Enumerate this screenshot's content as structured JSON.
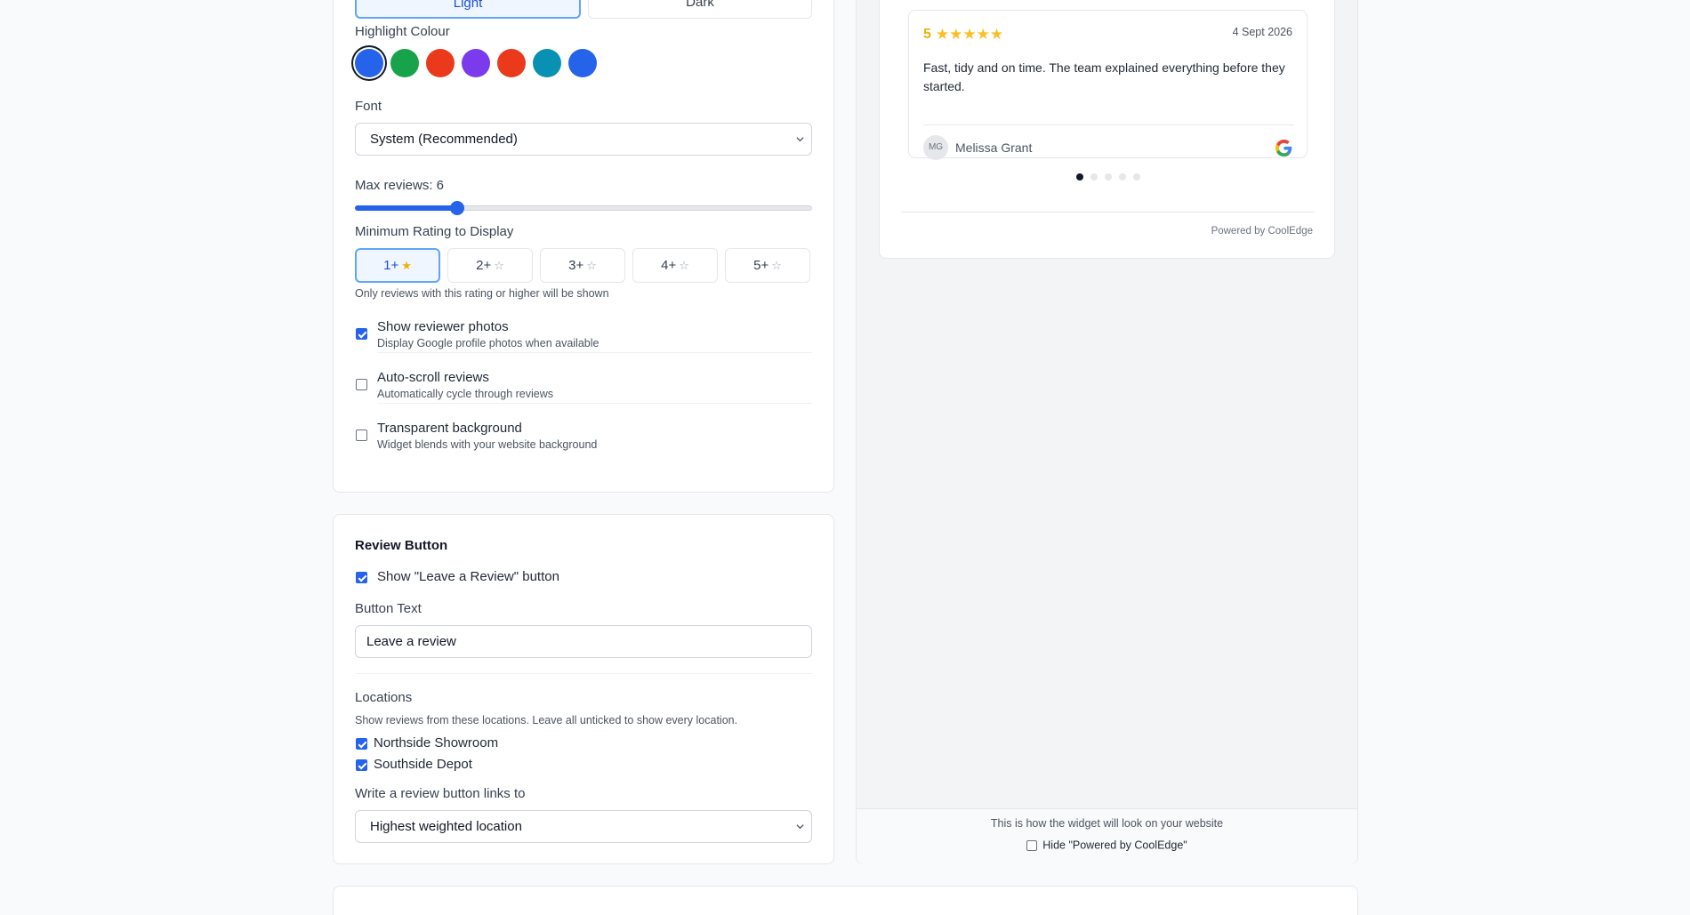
{
  "theme": {
    "light_label": "Light",
    "dark_label": "Dark"
  },
  "highlight": {
    "label": "Highlight Colour",
    "swatches": [
      "#2563eb",
      "#16a34a",
      "#ea3a1b",
      "#7c3aed",
      "#ea3a1b",
      "#0891b2",
      "#2563eb"
    ]
  },
  "font": {
    "label": "Font",
    "value": "System (Recommended)"
  },
  "max_reviews": {
    "label": "Max reviews: 6",
    "value": 6,
    "min": 1,
    "max": 50
  },
  "rating": {
    "label": "Minimum Rating to Display",
    "options": [
      "1+",
      "2+",
      "3+",
      "4+",
      "5+"
    ],
    "selected": "1+",
    "help": "Only reviews with this rating or higher will be shown"
  },
  "options": {
    "photos": {
      "title": "Show reviewer photos",
      "desc": "Display Google profile photos when available",
      "checked": true
    },
    "autoscroll": {
      "title": "Auto-scroll reviews",
      "desc": "Automatically cycle through reviews",
      "checked": false
    },
    "transparent": {
      "title": "Transparent background",
      "desc": "Widget blends with your website background",
      "checked": false
    }
  },
  "review_button": {
    "heading": "Review Button",
    "show_label": "Show \"Leave a Review\" button",
    "show_checked": true,
    "text_label": "Button Text",
    "text_value": "Leave a review"
  },
  "locations": {
    "heading": "Locations",
    "help": "Show reviews from these locations. Leave all unticked to show every location.",
    "items": [
      {
        "name": "Northside Showroom",
        "checked": true
      },
      {
        "name": "Southside Depot",
        "checked": true
      }
    ],
    "link_label": "Write a review button links to",
    "link_value": "Highest weighted location"
  },
  "preview": {
    "review": {
      "rating": "5",
      "stars": "★★★★★",
      "date": "4 Sept 2026",
      "text": "Fast, tidy and on time. The team explained everything before they started.",
      "initials": "MG",
      "name": "Melissa Grant"
    },
    "dots": 5,
    "active_dot": 0,
    "powered": "Powered by CoolEdge",
    "caption": "This is how the widget will look on your website",
    "hide_label": "Hide \"Powered by CoolEdge\""
  },
  "colors": {
    "accent": "#2563eb",
    "star": "#fbbf24"
  }
}
